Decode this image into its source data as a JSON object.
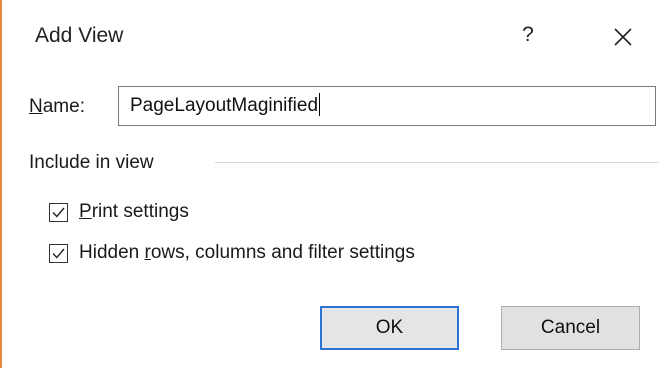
{
  "dialog": {
    "title": "Add View",
    "help_label": "?",
    "close_icon": "close-icon"
  },
  "name_field": {
    "label_underlined": "N",
    "label_rest": "ame:",
    "value": "PageLayoutMaginified"
  },
  "group": {
    "label": "Include in view"
  },
  "options": [
    {
      "underlined": "P",
      "rest": "rint settings",
      "checked": true
    },
    {
      "prefix": "Hidden ",
      "underlined": "r",
      "rest": "ows, columns and filter settings",
      "checked": true
    }
  ],
  "buttons": {
    "ok": "OK",
    "cancel": "Cancel"
  },
  "colors": {
    "accent_border": "#e8883a",
    "default_button_border": "#2b74d1"
  }
}
